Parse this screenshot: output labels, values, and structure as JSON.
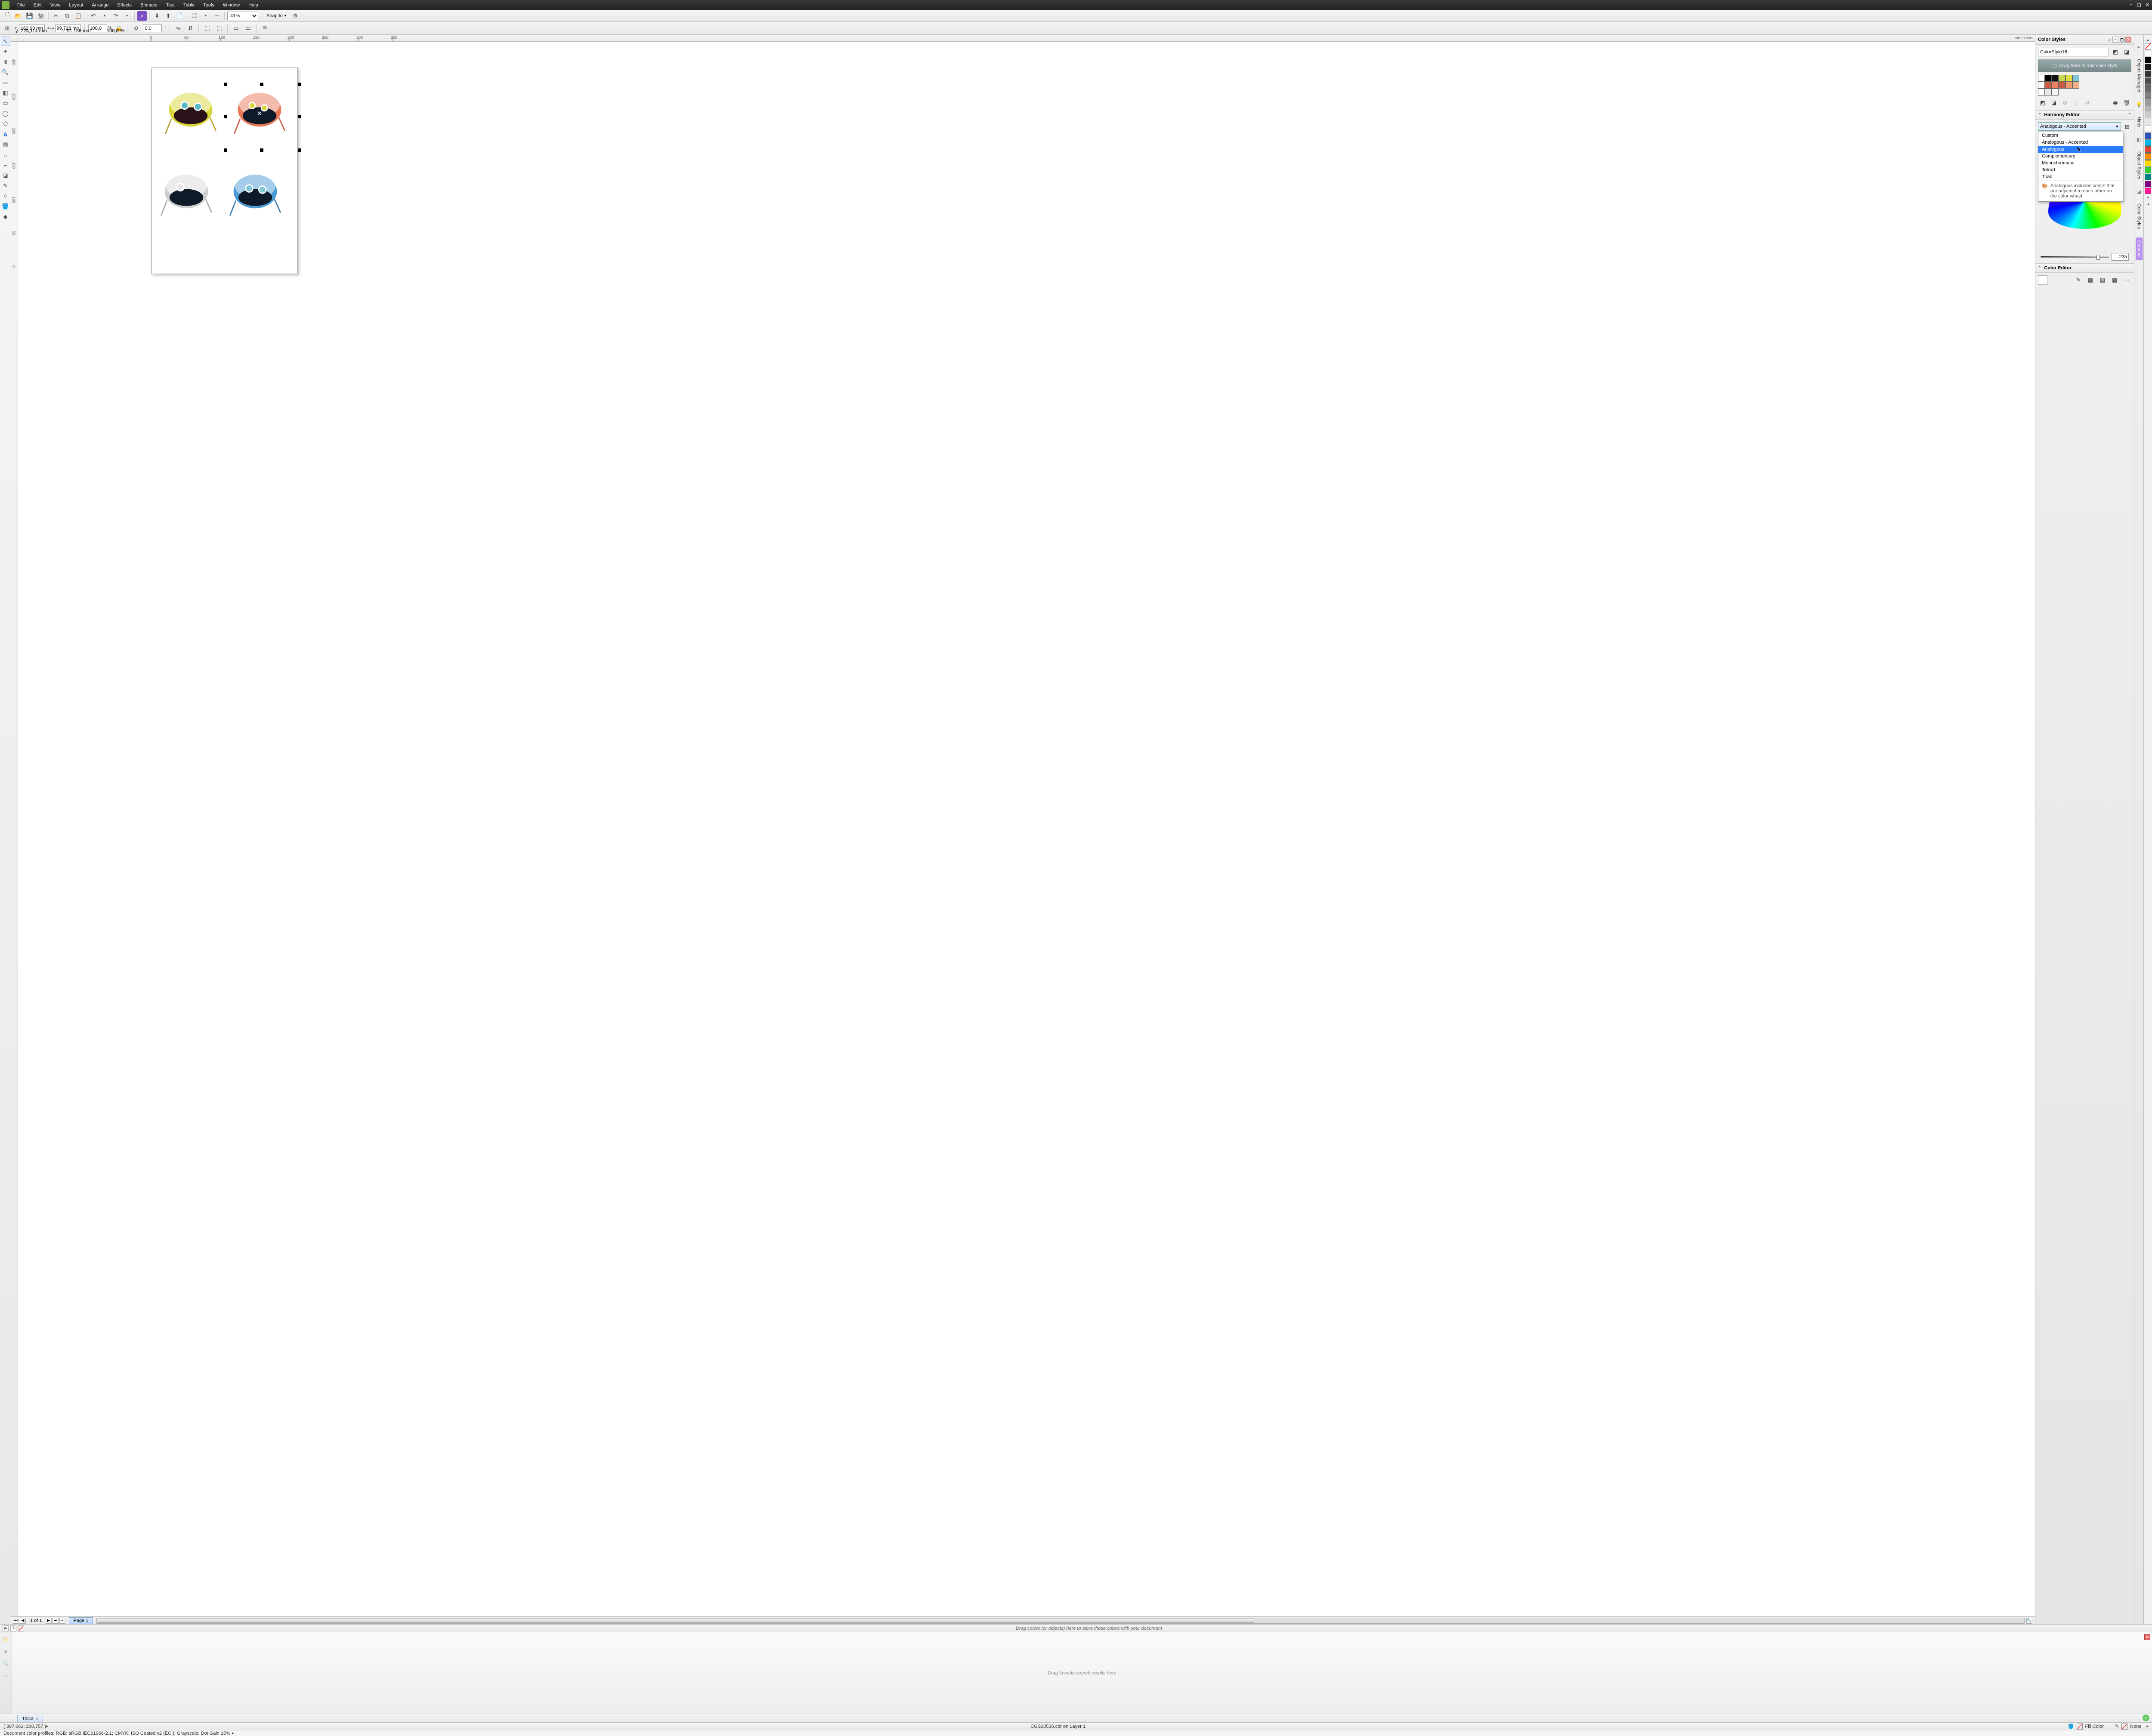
{
  "menu": {
    "file": "File",
    "edit": "Edit",
    "view": "View",
    "layout": "Layout",
    "arrange": "Arrange",
    "effects": "Effects",
    "bitmaps": "Bitmaps",
    "text": "Text",
    "table": "Table",
    "tools": "Tools",
    "window": "Window",
    "help": "Help"
  },
  "toolbar": {
    "zoom": "41%",
    "snap": "Snap to"
  },
  "propbar": {
    "x_label": "x:",
    "y_label": "y:",
    "x": "162,99 mm",
    "y": "224,114 mm",
    "w": "99,728 mm",
    "h": "91,156 mm",
    "sx": "100,0",
    "sy": "100,0",
    "pct": "%",
    "rot": "0,0",
    "deg": "°"
  },
  "ruler": {
    "units": "millimeters",
    "ticks": [
      "0",
      "50",
      "100",
      "150",
      "200",
      "250",
      "300",
      "350"
    ],
    "vticks": [
      "0",
      "50",
      "100",
      "150",
      "200",
      "250",
      "300"
    ]
  },
  "docker": {
    "title": "Color Styles",
    "style_name": "ColorStyle16",
    "drag_hint": "Drag here to add color style",
    "swatches": [
      "#ffffff",
      "#000000",
      "#111111",
      "#c8d84a",
      "#dede3e",
      "#7fc6d6",
      "#ffffff",
      "#c85a42",
      "#f08060",
      "#c85a42",
      "#f49a6a",
      "#f4b28a",
      "#ffffff",
      "#e8e8e8",
      "#f5f5f5"
    ],
    "harmony_title": "Harmony Editor",
    "harmony_selected": "Analogous - Accented",
    "harmony_options": [
      "Custom",
      "Analogous - Accented",
      "Analogous",
      "Complementary",
      "Monochromatic",
      "Tetrad",
      "Triad"
    ],
    "harmony_highlighted": "Analogous",
    "harmony_desc": "Analogous includes colors that are adjacent to each other on the color wheel.",
    "slider_value": "235",
    "color_editor": "Color Editor"
  },
  "vtabs": {
    "manager": "Object Manager",
    "hints": "Hints",
    "styles": "Object Styles",
    "colorstyles": "Color Styles",
    "connect": "Connect"
  },
  "palette_colors": [
    "#ffffff",
    "#000000",
    "#1a1a1a",
    "#333333",
    "#4d4d4d",
    "#666666",
    "#808080",
    "#999999",
    "#b3b3b3",
    "#cccccc",
    "#e6e6e6",
    "#ffffff",
    "#2a52be",
    "#00b7eb",
    "#e34234",
    "#ff8c00",
    "#ffd700",
    "#32cd32",
    "#008080",
    "#800080",
    "#ff1493"
  ],
  "page_nav": {
    "info": "1 of 1",
    "tab": "Page 1"
  },
  "doc_tray": {
    "hint": "Drag colors (or objects) here to store these colors with your document"
  },
  "search": {
    "hint": "Drag favorite search results here",
    "tab": "Tálca"
  },
  "status": {
    "coords": "( 397,063; 200,757 )",
    "doc": "CGS30536.cdr on Layer 1",
    "fill": "Fill Color",
    "none": "None"
  },
  "profile": {
    "text": "Document color profiles: RGB: sRGB IEC61966-2.1; CMYK: ISO Coated v2 (ECI); Grayscale: Dot Gain 15%"
  }
}
